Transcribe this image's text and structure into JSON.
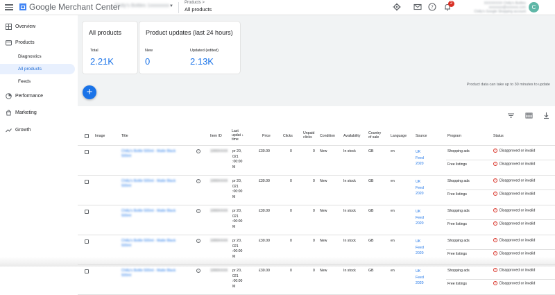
{
  "header": {
    "brand": "Google Merchant Center",
    "account_name": "Chilly's Bottles 1xxxxxxxx",
    "breadcrumb_parent": "Products >",
    "page_title": "All products",
    "notification_count": "2",
    "user_line1": "XXXXXXXX Chilly's Bottles",
    "user_line2": "xxxxxxxx@xxxxxxx.com",
    "user_line3": "Chilly's Google Shopping account",
    "avatar_letter": "C"
  },
  "sidebar": {
    "items": [
      {
        "label": "Overview",
        "icon": "overview-icon"
      },
      {
        "label": "Products",
        "icon": "products-icon"
      },
      {
        "label": "Performance",
        "icon": "performance-icon"
      },
      {
        "label": "Marketing",
        "icon": "marketing-icon"
      },
      {
        "label": "Growth",
        "icon": "growth-icon"
      }
    ],
    "sub_items": [
      {
        "label": "Diagnostics"
      },
      {
        "label": "All products",
        "active": true
      },
      {
        "label": "Feeds"
      }
    ]
  },
  "summary": {
    "all_products": {
      "title": "All products",
      "label": "Total",
      "value": "2.21K"
    },
    "updates": {
      "title": "Product updates (last 24 hours)",
      "new_label": "New",
      "new_value": "0",
      "updated_label": "Updated (edited)",
      "updated_value": "2.13K"
    }
  },
  "notice": "Product data can take up to 30 minutes to update",
  "fab_label": "+",
  "table": {
    "headers": {
      "image": "Image",
      "title": "Title",
      "item_id": "Item ID",
      "last_update": [
        "Last",
        "updat",
        "time"
      ],
      "sort_arrow": "↓",
      "price": "Price",
      "clicks": "Clicks",
      "unpaid_clicks": [
        "Unpaid",
        "clicks"
      ],
      "condition": "Condition",
      "availability": "Availability",
      "country": [
        "Country",
        "of sale"
      ],
      "language": "Language",
      "source": "Source",
      "program": "Program",
      "status": "Status"
    },
    "rows": [
      {
        "title": [
          "Chilly's Bottle 500ml - Matte Black",
          "500ml"
        ],
        "item_id": "1000XXXX",
        "time": [
          "pr 20,",
          "021",
          ":00:00",
          "M"
        ],
        "price": "£30.00",
        "clicks": "0",
        "unpaid": "0",
        "condition": "New",
        "availability": "In stock",
        "country": "GB",
        "language": "en",
        "source": [
          "UK",
          "Feed",
          "2020"
        ],
        "programs": [
          "Shopping ads",
          "Free listings"
        ],
        "statuses": [
          "Disapproved or invalid",
          "Disapproved or invalid"
        ]
      },
      {
        "title": [
          "Chilly's Bottle 500ml - Matte Black",
          "500ml"
        ],
        "item_id": "1000XXXX",
        "time": [
          "pr 20,",
          "021",
          ":00:00",
          "M"
        ],
        "price": "£30.00",
        "clicks": "0",
        "unpaid": "0",
        "condition": "New",
        "availability": "In stock",
        "country": "GB",
        "language": "en",
        "source": [
          "UK",
          "Feed",
          "2020"
        ],
        "programs": [
          "Shopping ads",
          "Free listings"
        ],
        "statuses": [
          "Disapproved or invalid",
          "Disapproved or invalid"
        ]
      },
      {
        "title": [
          "Chilly's Bottle 500ml - Matte Black",
          "500ml"
        ],
        "item_id": "1000XXXX",
        "time": [
          "pr 20,",
          "021",
          ":00:00",
          "M"
        ],
        "price": "£30.00",
        "clicks": "0",
        "unpaid": "0",
        "condition": "New",
        "availability": "In stock",
        "country": "GB",
        "language": "en",
        "source": [
          "UK",
          "Feed",
          "2020"
        ],
        "programs": [
          "Shopping ads",
          "Free listings"
        ],
        "statuses": [
          "Disapproved or invalid",
          "Disapproved or invalid"
        ]
      },
      {
        "title": [
          "Chilly's Bottle 500ml - Matte Black",
          "500ml"
        ],
        "item_id": "1000XXXX",
        "time": [
          "pr 20,",
          "021",
          ":00:00",
          "M"
        ],
        "price": "£30.00",
        "clicks": "0",
        "unpaid": "0",
        "condition": "New",
        "availability": "In stock",
        "country": "GB",
        "language": "en",
        "source": [
          "UK",
          "Feed",
          "2020"
        ],
        "programs": [
          "Shopping ads",
          "Free listings"
        ],
        "statuses": [
          "Disapproved or invalid",
          "Disapproved or invalid"
        ]
      },
      {
        "title": [
          "Chilly's Bottle 500ml - Matte Black",
          "500ml"
        ],
        "item_id": "1000XXXX",
        "time": [
          "pr 20,",
          "021",
          ":00:00",
          "M"
        ],
        "price": "£30.00",
        "clicks": "0",
        "unpaid": "0",
        "condition": "New",
        "availability": "In stock",
        "country": "GB",
        "language": "en",
        "source": [
          "UK",
          "Feed",
          "2020"
        ],
        "programs": [
          "Shopping ads",
          "Free listings"
        ],
        "statuses": [
          "Disapproved or invalid",
          "Disapproved or invalid"
        ]
      }
    ]
  },
  "colors": {
    "accent": "#1a73e8",
    "error": "#d93025",
    "active_bg": "#e8f0fe"
  }
}
